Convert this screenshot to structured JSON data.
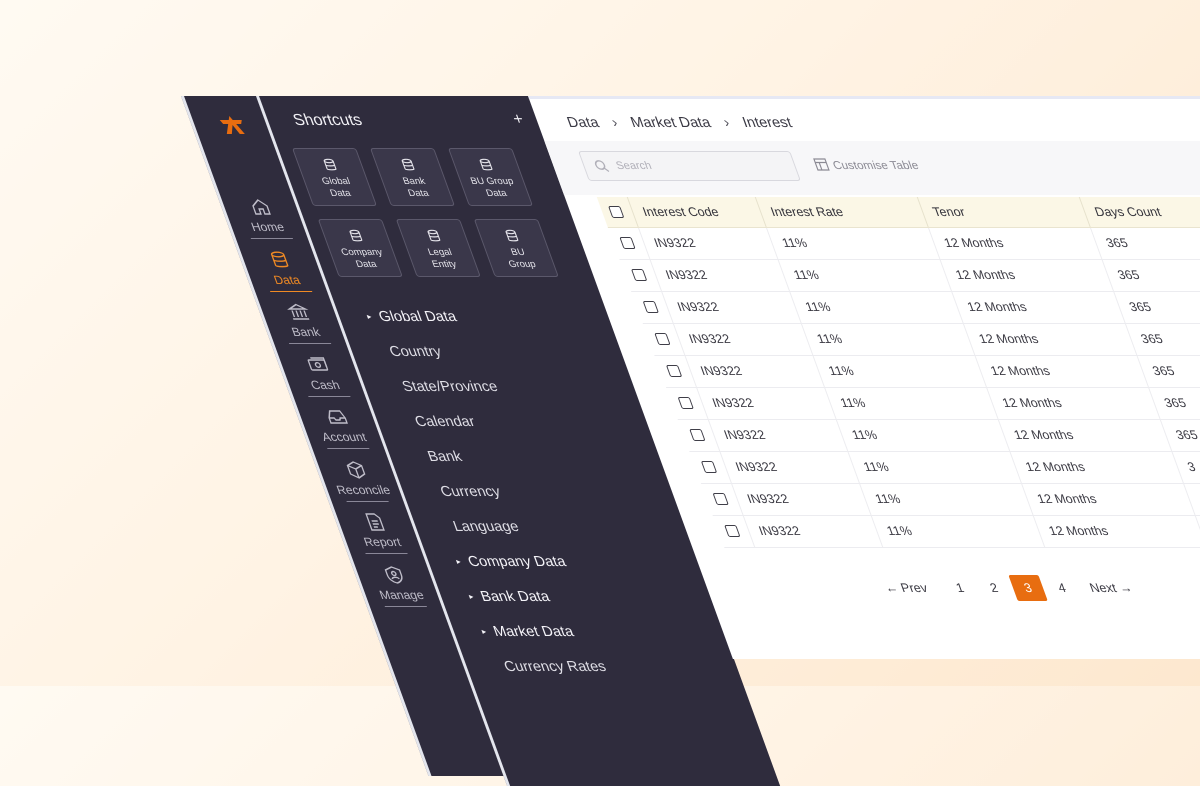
{
  "colors": {
    "accent": "#e86d10",
    "sidebar": "#2f2c3d",
    "header_row": "#fbf7e6"
  },
  "rail": {
    "logo": "app-logo-icon",
    "items": [
      {
        "label": "Home",
        "icon": "home-icon"
      },
      {
        "label": "Data",
        "icon": "database-icon",
        "active": true
      },
      {
        "label": "Bank",
        "icon": "bank-icon"
      },
      {
        "label": "Cash",
        "icon": "cash-icon"
      },
      {
        "label": "Account",
        "icon": "inbox-icon"
      },
      {
        "label": "Reconcile",
        "icon": "box-icon"
      },
      {
        "label": "Report",
        "icon": "document-icon"
      },
      {
        "label": "Manage",
        "icon": "shield-user-icon"
      }
    ]
  },
  "shortcuts": {
    "title": "Shortcuts",
    "add": "+",
    "tiles": [
      {
        "line1": "Global",
        "line2": "Data"
      },
      {
        "line1": "Bank",
        "line2": "Data"
      },
      {
        "line1": "BU Group",
        "line2": "Data"
      },
      {
        "line1": "Company",
        "line2": "Data"
      },
      {
        "line1": "Legal",
        "line2": "Entity"
      },
      {
        "line1": "BU",
        "line2": "Group"
      }
    ],
    "tree": [
      {
        "label": "Global Data",
        "expander": true
      },
      {
        "label": "Country"
      },
      {
        "label": "State/Province"
      },
      {
        "label": "Calendar"
      },
      {
        "label": "Bank"
      },
      {
        "label": "Currency"
      },
      {
        "label": "Language"
      },
      {
        "label": "Company Data",
        "expander": true
      },
      {
        "label": "Bank Data",
        "expander": true
      },
      {
        "label": "Market Data",
        "expander": true
      },
      {
        "label": "Currency Rates"
      }
    ]
  },
  "breadcrumb": [
    "Data",
    "Market Data",
    "Interest"
  ],
  "toolbar": {
    "search_placeholder": "Search",
    "customise_label": "Customise Table"
  },
  "table": {
    "columns": [
      "Interest Code",
      "Interest Rate",
      "Tenor",
      "Days Count"
    ],
    "rows": [
      [
        "IN9322",
        "11%",
        "12 Months",
        "365"
      ],
      [
        "IN9322",
        "11%",
        "12 Months",
        "365"
      ],
      [
        "IN9322",
        "11%",
        "12 Months",
        "365"
      ],
      [
        "IN9322",
        "11%",
        "12 Months",
        "365"
      ],
      [
        "IN9322",
        "11%",
        "12 Months",
        "365"
      ],
      [
        "IN9322",
        "11%",
        "12 Months",
        "365"
      ],
      [
        "IN9322",
        "11%",
        "12 Months",
        "365"
      ],
      [
        "IN9322",
        "11%",
        "12 Months",
        "3"
      ],
      [
        "IN9322",
        "11%",
        "12 Months",
        ""
      ],
      [
        "IN9322",
        "11%",
        "12 Months",
        ""
      ]
    ]
  },
  "pagination": {
    "prev": "Prev",
    "next": "Next",
    "pages": [
      "1",
      "2",
      "3",
      "4"
    ],
    "current": "3"
  }
}
